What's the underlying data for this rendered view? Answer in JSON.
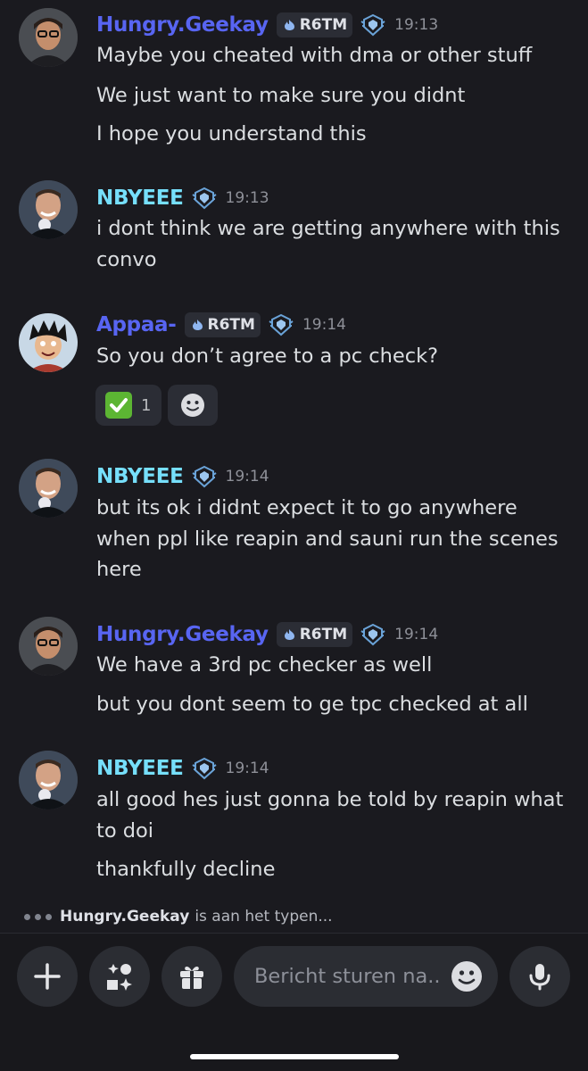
{
  "messages": [
    {
      "author": "Hungry.Geekay",
      "author_color": "#5865f2",
      "tag": "R6TM",
      "time": "19:13",
      "lines": [
        "Maybe you cheated with dma or other stuff",
        "We just want to make sure you didnt",
        "I hope you understand this"
      ]
    },
    {
      "author": "NBYEEE",
      "author_color": "#76dffb",
      "time": "19:13",
      "lines": [
        "i dont think we are getting anywhere with this",
        "convo"
      ]
    },
    {
      "author": "Appaa-",
      "author_color": "#5865f2",
      "tag": "R6TM",
      "time": "19:14",
      "lines": [
        "So you don’t agree to a pc check?"
      ],
      "reaction": {
        "emoji": "check-mark-emoji",
        "count": "1"
      }
    },
    {
      "author": "NBYEEE",
      "author_color": "#76dffb",
      "time": "19:14",
      "lines": [
        "but its ok i didnt expect it to go anywhere",
        "when ppl like reapin and sauni run the scenes",
        "here"
      ]
    },
    {
      "author": "Hungry.Geekay",
      "author_color": "#5865f2",
      "tag": "R6TM",
      "time": "19:14",
      "lines": [
        "We have a 3rd pc checker as well",
        "but you dont seem to ge tpc checked at all"
      ]
    },
    {
      "author": "NBYEEE",
      "author_color": "#76dffb",
      "time": "19:14",
      "lines": [
        "all good hes just gonna be told by reapin what",
        "to doi",
        "thankfully decline"
      ]
    }
  ],
  "typing": {
    "user": "Hungry.Geekay",
    "text": "is aan het typen..."
  },
  "composer": {
    "placeholder": "Bericht sturen na.."
  },
  "icons": [
    "plus-icon",
    "apps-icon",
    "gift-icon",
    "emoji-icon",
    "microphone-icon",
    "rank-badge-icon"
  ],
  "colors": {
    "background": "#1a1a1f",
    "accent": "#5865f2",
    "teal_name": "#76dffb"
  }
}
